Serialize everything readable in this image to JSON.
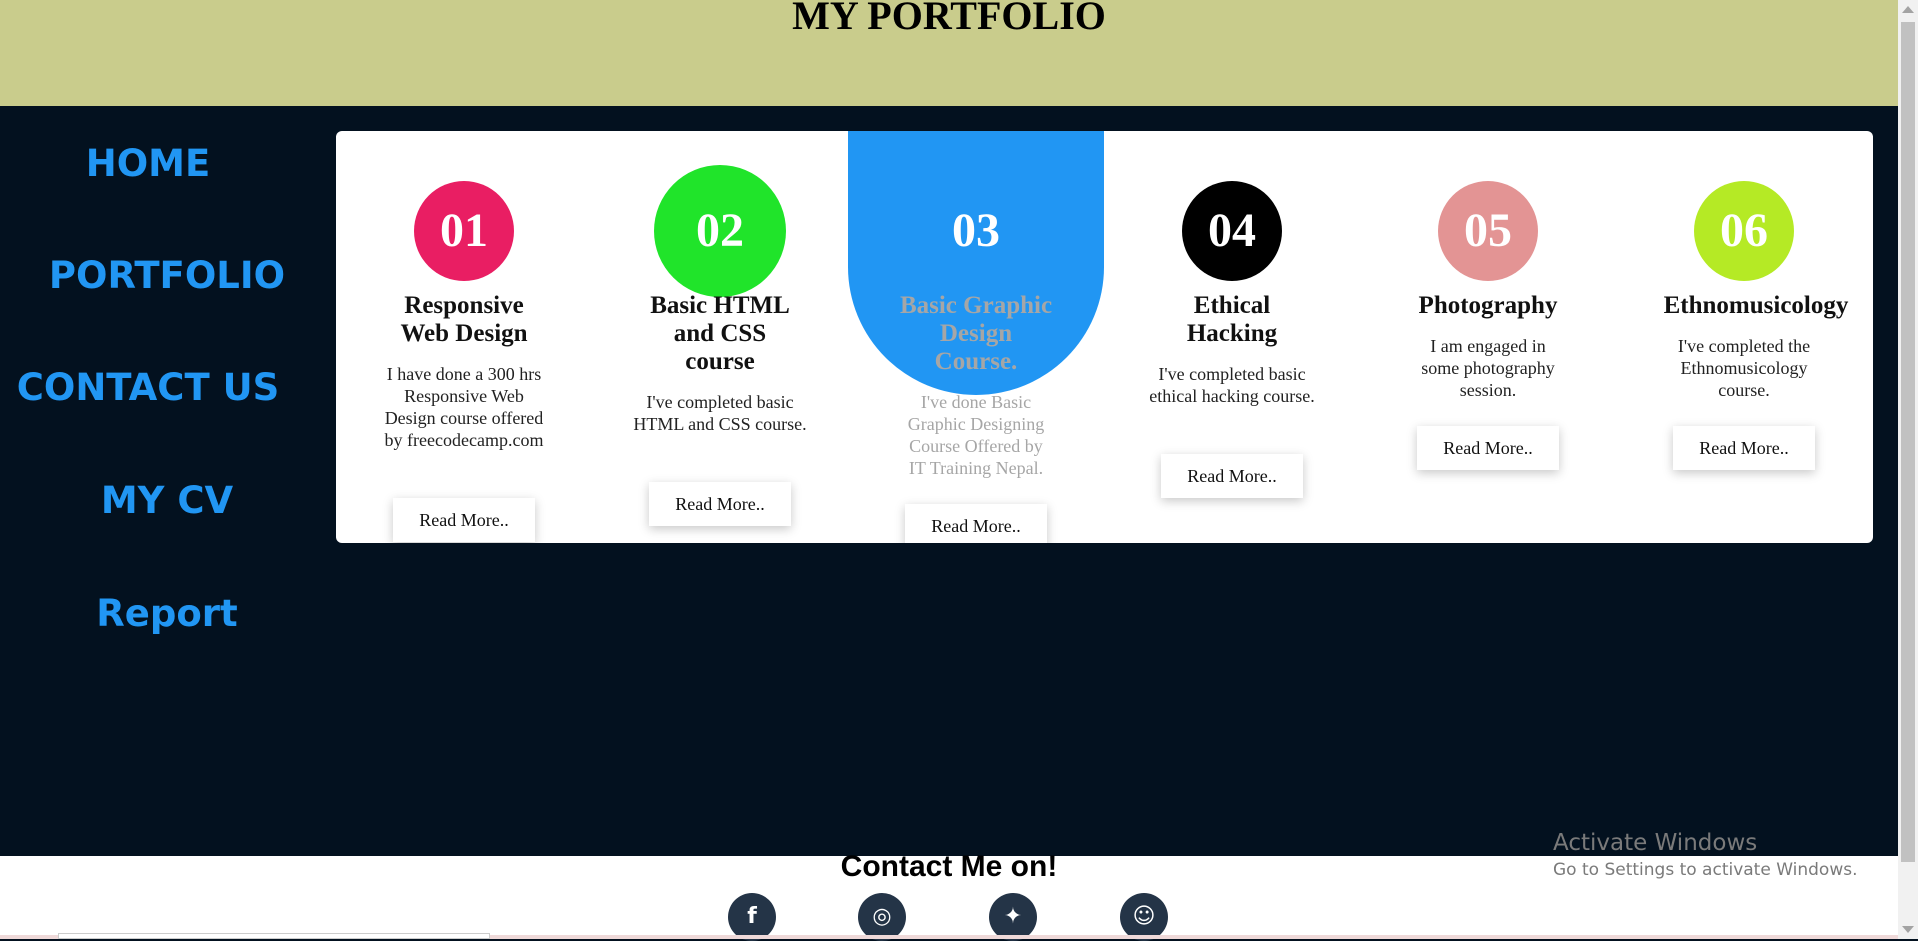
{
  "header": {
    "title": "MY PORTFOLIO"
  },
  "colors": {
    "header_bg": "#c9cc8c",
    "page_bg": "#03111f",
    "nav_text": "#2196f3",
    "active_card": "#2196f3"
  },
  "sidebar": {
    "items": [
      {
        "label": "HOME"
      },
      {
        "label": "PORTFOLIO"
      },
      {
        "label": "CONTACT US"
      },
      {
        "label": "MY CV"
      },
      {
        "label": "Report"
      }
    ]
  },
  "cards": [
    {
      "num": "01",
      "color": "#e91e63",
      "title": "Responsive Web Design",
      "text": "I have done a 300 hrs Responsive Web Design course offered by freecodecamp.com",
      "button": "Read More.."
    },
    {
      "num": "02",
      "color": "#20e42a",
      "title": "Basic HTML and CSS course",
      "text": "I've completed basic HTML and CSS course.",
      "button": "Read More.."
    },
    {
      "num": "03",
      "color": "#2196f3",
      "title": "Basic Graphic Design Course.",
      "text": "I've done Basic Graphic Designing Course Offered by IT Training Nepal.",
      "button": "Read More.."
    },
    {
      "num": "04",
      "color": "#000000",
      "title": "Ethical Hacking",
      "text": "I've completed basic ethical hacking course.",
      "button": "Read More.."
    },
    {
      "num": "05",
      "color": "#e39494",
      "title": "Photography",
      "text": "I am engaged in some photography session.",
      "button": "Read More.."
    },
    {
      "num": "06",
      "color": "#b5ea25",
      "title": "Ethnomusicology",
      "text": "I've completed the Ethnomusicology course.",
      "button": "Read More.."
    }
  ],
  "footer": {
    "title": "Contact Me on!",
    "social": [
      {
        "icon": "facebook-icon",
        "glyph": "f"
      },
      {
        "icon": "instagram-icon",
        "glyph": "◎"
      },
      {
        "icon": "twitter-icon",
        "glyph": "✦"
      },
      {
        "icon": "snapchat-icon",
        "glyph": "☺"
      }
    ]
  },
  "watermark": {
    "line1": "Activate Windows",
    "line2": "Go to Settings to activate Windows."
  }
}
